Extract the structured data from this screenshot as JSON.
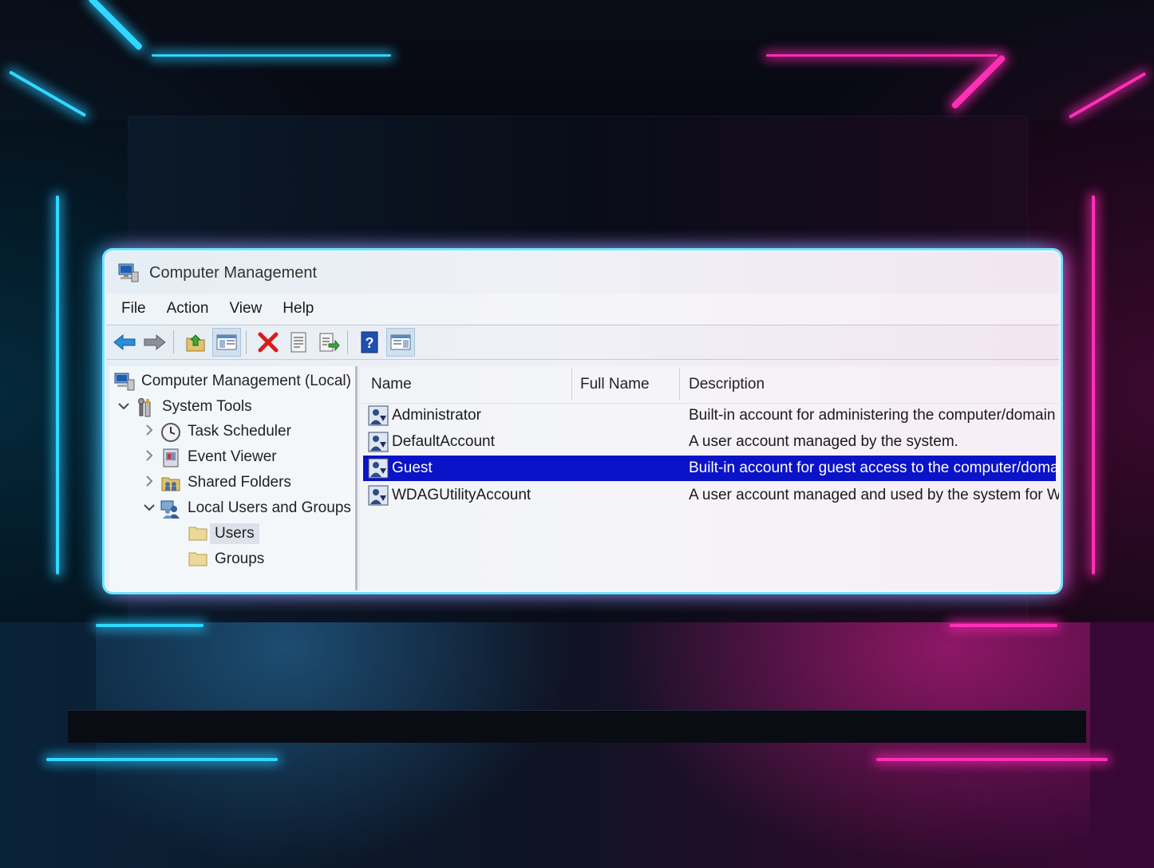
{
  "window": {
    "title": "Computer Management"
  },
  "menu": [
    "File",
    "Action",
    "View",
    "Help"
  ],
  "toolbar": [
    {
      "icon": "back-arrow-icon"
    },
    {
      "icon": "forward-arrow-icon"
    },
    {
      "icon": "up-folder-icon"
    },
    {
      "icon": "show-hide-console-tree-icon"
    },
    {
      "icon": "delete-icon"
    },
    {
      "icon": "properties-icon"
    },
    {
      "icon": "export-list-icon"
    },
    {
      "icon": "help-icon"
    },
    {
      "icon": "show-hide-action-pane-icon"
    }
  ],
  "tree": {
    "root": "Computer Management (Local)",
    "system_tools": "System Tools",
    "task_scheduler": "Task Scheduler",
    "event_viewer": "Event Viewer",
    "shared_folders": "Shared Folders",
    "local_users_groups": "Local Users and Groups",
    "users": "Users",
    "groups": "Groups"
  },
  "list": {
    "columns": [
      "Name",
      "Full Name",
      "Description"
    ],
    "rows": [
      {
        "name": "Administrator",
        "full_name": "",
        "description": "Built-in account for administering the computer/domain"
      },
      {
        "name": "DefaultAccount",
        "full_name": "",
        "description": "A user account managed by the system."
      },
      {
        "name": "Guest",
        "full_name": "",
        "description": "Built-in account for guest access to the computer/domain",
        "selected": true
      },
      {
        "name": "WDAGUtilityAccount",
        "full_name": "",
        "description": "A user account managed and used by the system for Wi..."
      }
    ]
  },
  "colors": {
    "selection": "#0a13c8",
    "neon_cyan": "#2fd8ff",
    "neon_magenta": "#ff2fb7"
  }
}
